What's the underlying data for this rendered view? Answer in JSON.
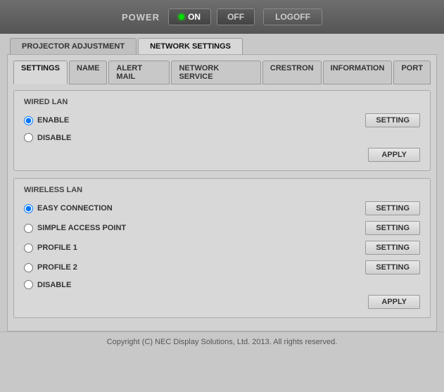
{
  "topbar": {
    "power_label": "POWER",
    "on_label": "ON",
    "off_label": "OFF",
    "logoff_label": "LOGOFF"
  },
  "main_tabs": [
    {
      "id": "projector-adjustment",
      "label": "PROJECTOR ADJUSTMENT",
      "active": false
    },
    {
      "id": "network-settings",
      "label": "NETWORK SETTINGS",
      "active": true
    }
  ],
  "sub_tabs": [
    {
      "id": "settings",
      "label": "SETTINGS",
      "active": true
    },
    {
      "id": "name",
      "label": "NAME",
      "active": false
    },
    {
      "id": "alert-mail",
      "label": "ALERT MAIL",
      "active": false
    },
    {
      "id": "network-service",
      "label": "NETWORK SERVICE",
      "active": false
    },
    {
      "id": "crestron",
      "label": "CRESTRON",
      "active": false
    },
    {
      "id": "information",
      "label": "INFORMATION",
      "active": false
    },
    {
      "id": "port",
      "label": "PORT",
      "active": false
    }
  ],
  "wired_lan": {
    "title": "WIRED LAN",
    "options": [
      {
        "id": "wired-enable",
        "label": "ENABLE",
        "checked": true,
        "has_setting": true
      },
      {
        "id": "wired-disable",
        "label": "DISABLE",
        "checked": false,
        "has_setting": false
      }
    ],
    "setting_label": "SETTING",
    "apply_label": "APPLY"
  },
  "wireless_lan": {
    "title": "WIRELESS LAN",
    "options": [
      {
        "id": "wireless-easy",
        "label": "EASY CONNECTION",
        "checked": true,
        "has_setting": true
      },
      {
        "id": "wireless-simple",
        "label": "SIMPLE ACCESS POINT",
        "checked": false,
        "has_setting": true
      },
      {
        "id": "wireless-profile1",
        "label": "PROFILE 1",
        "checked": false,
        "has_setting": true
      },
      {
        "id": "wireless-profile2",
        "label": "PROFILE 2",
        "checked": false,
        "has_setting": true
      },
      {
        "id": "wireless-disable",
        "label": "DISABLE",
        "checked": false,
        "has_setting": false
      }
    ],
    "setting_label": "SETTING",
    "apply_label": "APPLY"
  },
  "footer": {
    "copyright": "Copyright (C) NEC Display Solutions, Ltd. 2013. All rights reserved."
  }
}
